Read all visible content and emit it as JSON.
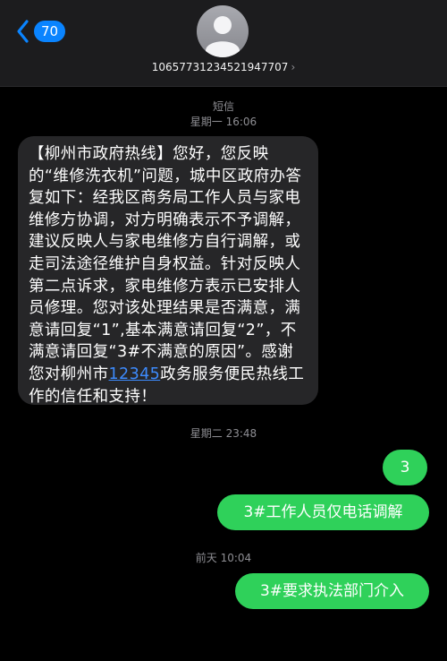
{
  "header": {
    "unread_count": "70",
    "contact_number": "10657731234521947707",
    "contact_chevron": "›",
    "icons": [
      "chevron-left-icon",
      "person-avatar-icon",
      "chevron-right-icon"
    ]
  },
  "conversation": {
    "service_label": "短信",
    "first_timestamp": "星期一 16:06",
    "incoming": {
      "text_before_link": "【柳州市政府热线】您好，您反映的“维修洗衣机”问题，城中区政府办答复如下：经我区商务局工作人员与家电维修方协调，对方明确表示不予调解，建议反映人与家电维修方自行调解，或走司法途径维护自身权益。针对反映人第二点诉求，家电维修方表示已安排人员修理。您对该处理结果是否满意，满意请回复“1”,基本满意请回复“2”，不满意请回复“3#不满意的原因”。感谢您对柳州市",
      "link_text": "12345",
      "text_after_link": "政务服务便民热线工作的信任和支持！"
    },
    "second_timestamp": "星期二 23:48",
    "outgoing_1": "3",
    "outgoing_2": "3#工作人员仅电话调解",
    "third_timestamp": "前天 10:04",
    "outgoing_3": "3#要求执法部门介入",
    "colors": {
      "incoming_bubble": "#262628",
      "outgoing_bubble": "#2fd15a",
      "link": "#3d8bfd",
      "badge": "#0a84ff"
    }
  }
}
